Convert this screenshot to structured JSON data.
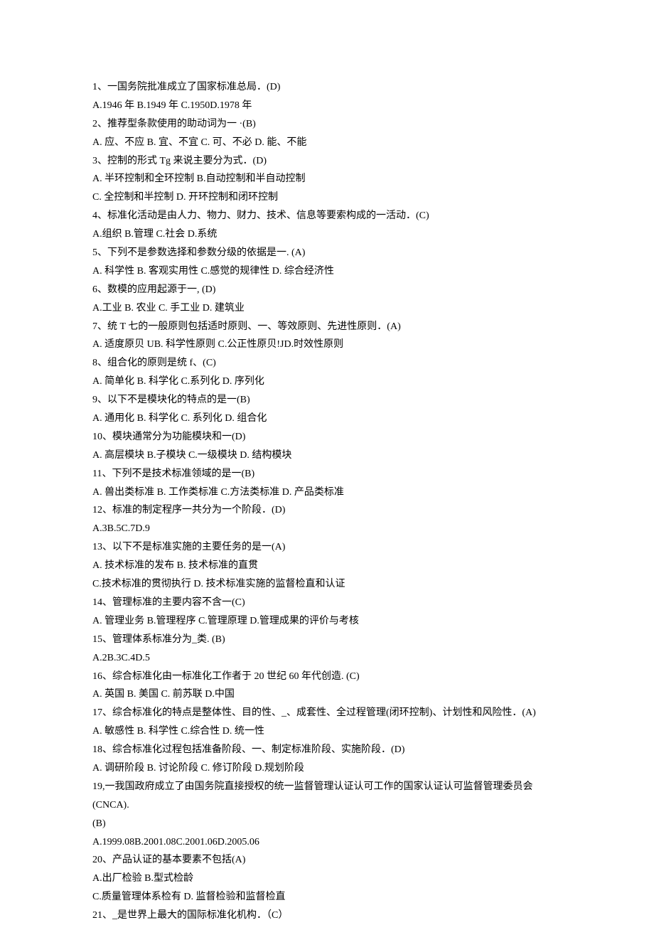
{
  "lines": [
    "1、一国务院批准成立了国家标准总局．(D)",
    "A.1946 年 B.1949 年 C.1950D.1978 年",
    "2、推荐型条款使用的助动词为一 ·(B)",
    "A. 应、不应 B. 宜、不宜 C. 可、不必 D. 能、不能",
    "3、控制的形式 Tg 来说主要分为式．(D)",
    "A. 半环控制和全环控制 B.自动控制和半自动控制",
    "C. 全控制和半控制 D. 开环控制和闭环控制",
    "4、标准化活动是由人力、物力、财力、技术、信息等要索构成的一活动．(C)",
    "A.组织 B.管理 C.社会 D.系统",
    "5、下列不是参数选择和参数分级的依据是一. (A)",
    "A. 科学性 B. 客观实用性 C.感觉的规律性 D. 综合经济性",
    "6、数模的应用起源于一, (D)",
    "A.工业 B. 农业 C. 手工业 D. 建筑业",
    "7、统 T 七的一般原则包括适时原则、一、等效原则、先进性原则．(A)",
    "A. 适度原贝 UB. 科学性原则 C.公正性原贝!JD.时效性原则",
    "8、组合化的原则是统 f、(C)",
    "A. 简单化 B. 科学化 C.系列化 D. 序列化",
    "9、以下不是模块化的特点的是一(B)",
    "A. 通用化 B. 科学化 C. 系列化 D. 组合化",
    "10、模块通常分为功能模块和一(D)",
    "A. 高层模块 B.子模块 C.一级模块 D. 结构模块",
    "11、下列不是技术标准领域的是一(B)",
    "A. 兽出类标准 B. 工作类标准 C.方法类标准 D. 产品类标准",
    "12、标准的制定程序一共分为一个阶段．(D)",
    "A.3B.5C.7D.9",
    "13、以下不是标准实施的主要任务的是一(A)",
    "A. 技术标准的发布 B. 技术标准的直贯",
    "C.技术标准的贯彻执行 D. 技术标准实施的监督检直和认证",
    "14、管理标准的主要内容不含一(C)",
    "A. 管理业务 B.管理程序 C.管理原理 D.管理成果的评价与考核",
    "15、管理体系标准分为_类. (B)",
    "A.2B.3C.4D.5",
    "16、综合标准化由一标准化工作者于 20 世纪 60 年代创造. (C)",
    "A. 英国 B. 美国 C. 前苏联 D.中国",
    "17、综合标准化的特点是整体性、目的性、_、成套性、全过程管理(闭环控制)、计划性和风险性．(A)",
    "A. 敏感性 B. 科学性 C.综合性 D. 统一性",
    "18、综合标准化过程包括准备阶段、一、制定标准阶段、实施阶段．(D)",
    "A. 调研阶段 B. 讨论阶段 C. 修订阶段 D.规划阶段",
    "19,一我国政府成立了由国务院直接授权的统一监督管理认证认可工作的国家认证认可监督管理委员会(CNCA).",
    "(B)",
    "A.1999.08B.2001.08C.2001.06D.2005.06",
    "20、产品认证的基本要素不包括(A)",
    "A.出厂检验 B.型式检龄",
    "C.质量管理体系检有 D. 监督检验和监督检直",
    "21、_是世界上最大的国际标准化机构．（C）"
  ]
}
